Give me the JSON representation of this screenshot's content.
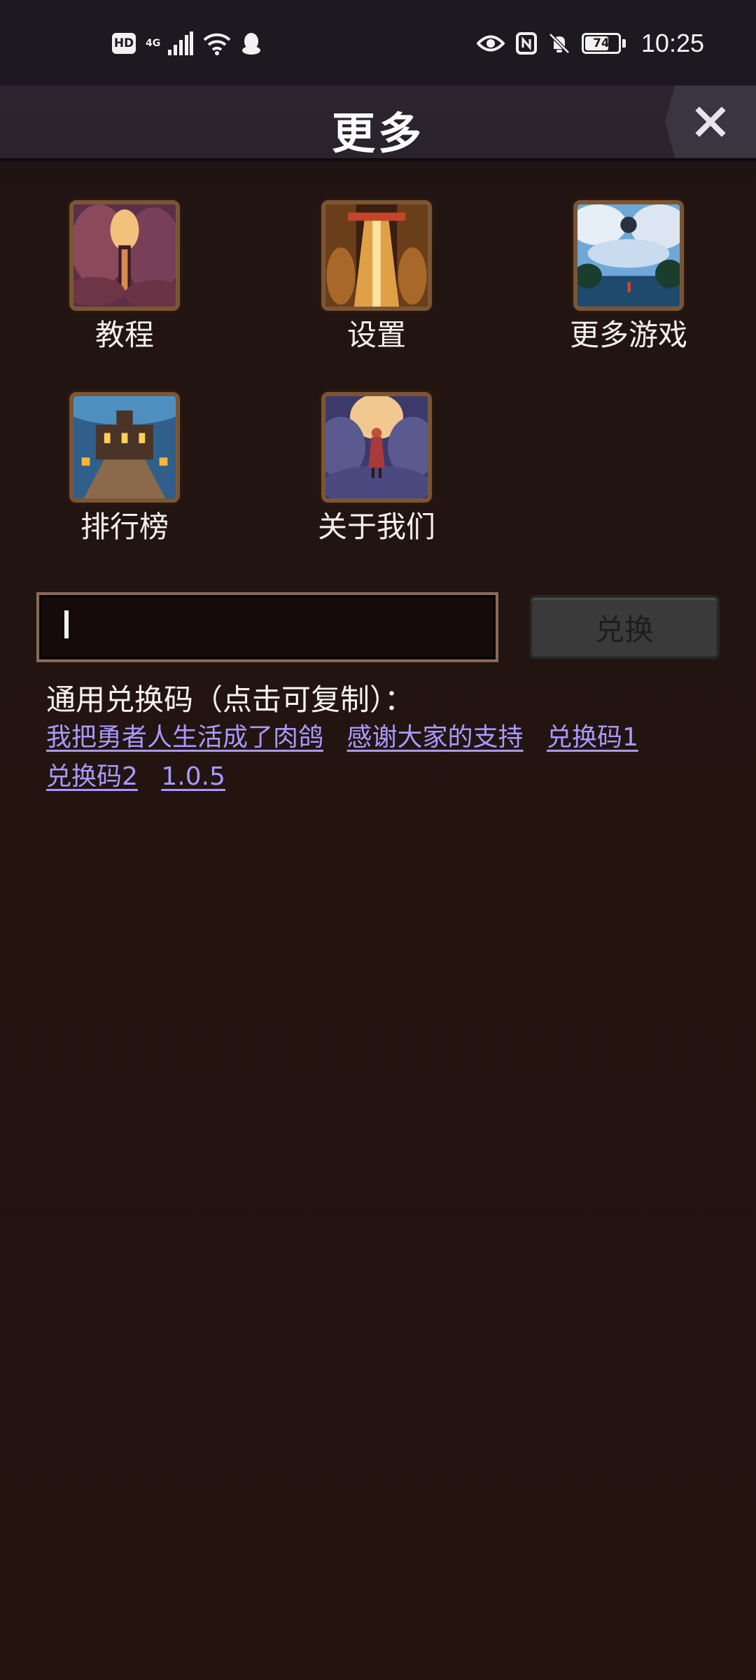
{
  "status_bar": {
    "hd_label": "HD",
    "network_label": "4G",
    "battery_level": "74",
    "battery_fraction": 0.74,
    "time": "10:25",
    "icons": [
      "hd-icon",
      "signal-icon",
      "wifi-icon",
      "qq-icon",
      "eye-icon",
      "nfc-icon",
      "bell-muted-icon",
      "battery-icon"
    ]
  },
  "header": {
    "title": "更多",
    "close_icon": "close-icon"
  },
  "menu": {
    "items": [
      {
        "label": "教程",
        "icon": "tutorial-icon"
      },
      {
        "label": "设置",
        "icon": "settings-icon"
      },
      {
        "label": "更多游戏",
        "icon": "more-games-icon"
      },
      {
        "label": "排行榜",
        "icon": "leaderboard-icon"
      },
      {
        "label": "关于我们",
        "icon": "about-us-icon"
      }
    ]
  },
  "redeem": {
    "input_value": "",
    "button_label": "兑换"
  },
  "codes": {
    "heading": "通用兑换码（点击可复制）：",
    "items": [
      "我把勇者人生活成了肉鸽",
      "感谢大家的支持",
      "兑换码1",
      "兑换码2",
      "1.0.5"
    ]
  },
  "colors": {
    "background": "#221310",
    "header": "#2a222c",
    "link": "#a89aff",
    "frame": "#7b5634"
  }
}
